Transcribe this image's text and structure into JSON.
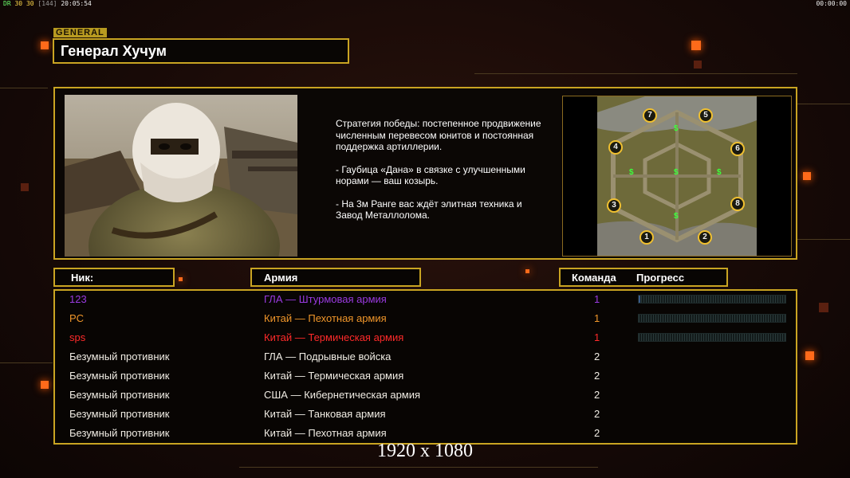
{
  "status": {
    "a": "DR",
    "b": "30",
    "c": "30",
    "d": "[144]",
    "time": "20:05:54"
  },
  "clock": "00:00:00",
  "general": {
    "tag": "GENERAL",
    "name": "Генерал Хучум"
  },
  "strategy": {
    "p1": "Стратегия победы: постепенное продвижение численным перевесом юнитов и постоянная поддержка артиллерии.",
    "p2": "- Гаубица «Дана» в связке с улучшенными норами — ваш козырь.",
    "p3": "- На 3м Ранге вас ждёт элитная техника и Завод Металлолома."
  },
  "map": {
    "numbers": [
      "1",
      "2",
      "3",
      "4",
      "5",
      "6",
      "7",
      "8"
    ],
    "dollar": "$"
  },
  "columns": {
    "nick": "Ник:",
    "army": "Армия",
    "team": "Команда",
    "progress": "Прогресс"
  },
  "colors": {
    "accent": "#c9a422",
    "purple": "#9a3ae0",
    "orange": "#f0962a",
    "red": "#ff2a2a",
    "white": "#f0ece4"
  },
  "players": [
    {
      "nick": "123",
      "army": "ГЛА — Штурмовая армия",
      "team": "1",
      "color": "#9a3ae0",
      "progress": 0.01
    },
    {
      "nick": "PC",
      "army": "Китай — Пехотная армия",
      "team": "1",
      "color": "#f0962a",
      "progress": 0.0
    },
    {
      "nick": "sps",
      "army": "Китай — Термическая армия",
      "team": "1",
      "color": "#ff2a2a",
      "progress": 0.0
    },
    {
      "nick": "Безумный противник",
      "army": "ГЛА — Подрывные войска",
      "team": "2",
      "color": "#f0ece4"
    },
    {
      "nick": "Безумный противник",
      "army": "Китай — Термическая армия",
      "team": "2",
      "color": "#f0ece4"
    },
    {
      "nick": "Безумный противник",
      "army": "США — Кибернетическая армия",
      "team": "2",
      "color": "#f0ece4"
    },
    {
      "nick": "Безумный противник",
      "army": "Китай — Танковая армия",
      "team": "2",
      "color": "#f0ece4"
    },
    {
      "nick": "Безумный противник",
      "army": "Китай — Пехотная армия",
      "team": "2",
      "color": "#f0ece4"
    }
  ],
  "resolution": "1920 x 1080"
}
